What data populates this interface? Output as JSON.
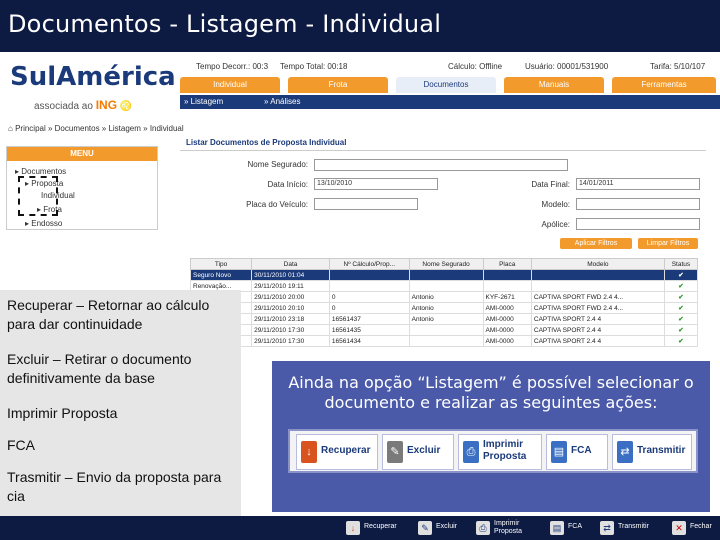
{
  "slide_title": "Documentos  - Listagem - Individual",
  "logo": {
    "main": "SulAmérica",
    "sub_prefix": "associada ao",
    "sub_brand": "ING"
  },
  "info_bar": [
    "Tempo Decorr.: 00:3",
    "Tempo Total: 00:18",
    "Cálculo: Offline",
    "Usuário: 00001/531900",
    "Tarifa: 5/10/107"
  ],
  "tabs": [
    {
      "label": "Individual"
    },
    {
      "label": "Frota"
    },
    {
      "label": "Documentos"
    },
    {
      "label": "Manuais"
    },
    {
      "label": "Ferramentas"
    }
  ],
  "subtabs": [
    "» Listagem",
    "» Análises"
  ],
  "breadcrumb": "Principal » Documentos » Listagem » Individual",
  "menu": {
    "title": "MENU",
    "items": [
      "Documentos",
      "Proposta",
      "Individual",
      "Frota",
      "Endosso"
    ]
  },
  "form": {
    "title": "Listar Documentos de Proposta Individual",
    "labels": {
      "nome_segurado": "Nome Segurado:",
      "data_inicio": "Data Início:",
      "data_final": "Data Final:",
      "placa": "Placa do Veículo:",
      "modelo": "Modelo:",
      "apolice": "Apólice:"
    },
    "values": {
      "data_inicio": "13/10/2010",
      "data_final": "14/01/2011"
    },
    "buttons": {
      "apply": "Aplicar Filtros",
      "clear": "Limpar Filtros"
    }
  },
  "grid": {
    "columns": [
      "Tipo",
      "Data",
      "Nº Cálculo/Prop...",
      "Nome Segurado",
      "Placa",
      "Modelo",
      "Status"
    ],
    "rows": [
      [
        "Seguro Novo",
        "30/11/2010 01:04",
        "",
        "",
        "",
        "",
        "✔"
      ],
      [
        "Renovação...",
        "29/11/2010 19:11",
        "",
        "",
        "",
        "",
        "✔"
      ],
      [
        "",
        "29/11/2010 20:00",
        "0",
        "Antonio",
        "KYF-2671",
        "CAPTIVA SPORT FWD 2.4 4...",
        "✔"
      ],
      [
        "",
        "29/11/2010 20:10",
        "0",
        "Antonio",
        "AMI-0000",
        "CAPTIVA SPORT FWD 2.4 4...",
        "✔"
      ],
      [
        "",
        "29/11/2010 23:18",
        "16561437",
        "Antonio",
        "AMI-0000",
        "CAPTIVA SPORT 2.4 4",
        "✔"
      ],
      [
        "",
        "29/11/2010 17:30",
        "16561435",
        "",
        "AMI-0000",
        "CAPTIVA SPORT 2.4 4",
        "✔"
      ],
      [
        "",
        "29/11/2010 17:30",
        "16561434",
        "",
        "AMI-0000",
        "CAPTIVA SPORT 2.4 4",
        "✔"
      ]
    ]
  },
  "left_notes": [
    "Recuperar – Retornar ao cálculo para dar continuidade",
    "Excluir – Retirar o documento definitivamente da base",
    "Imprimir Proposta",
    "FCA",
    "Trasmitir – Envio da proposta para cia"
  ],
  "callout": {
    "text": "Ainda na opção “Listagem” é possível selecionar o documento e realizar as seguintes ações:",
    "buttons": [
      {
        "label": "Recuperar",
        "icon": "arrow-down-icon",
        "color": "#d9531e"
      },
      {
        "label": "Excluir",
        "icon": "eraser-icon",
        "color": "#7a7a7a"
      },
      {
        "label": "Imprimir Proposta",
        "icon": "printer-icon",
        "color": "#3a6fc4"
      },
      {
        "label": "FCA",
        "icon": "document-icon",
        "color": "#3a6fc4"
      },
      {
        "label": "Transmitir",
        "icon": "transmit-icon",
        "color": "#3a6fc4"
      }
    ]
  },
  "bottom_bar": [
    {
      "label": "Recuperar",
      "glyph": "↓"
    },
    {
      "label": "Excluir",
      "glyph": "✎"
    },
    {
      "label": "Imprimir Proposta",
      "glyph": "⎙"
    },
    {
      "label": "FCA",
      "glyph": "▤"
    },
    {
      "label": "Transmitir",
      "glyph": "⇄"
    },
    {
      "label": "Fechar",
      "glyph": "✕"
    }
  ]
}
